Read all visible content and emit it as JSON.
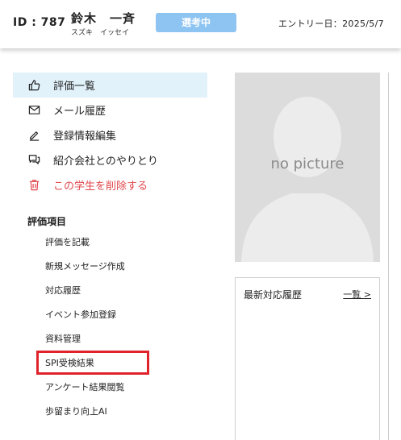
{
  "header": {
    "id_label": "ID : 787",
    "name": "鈴木　一斉",
    "name_kana": "スズキ　イッセイ",
    "status_badge": "選考中",
    "entry_date": "エントリー日：2025/5/7",
    "badge_color": "#8ec4f2"
  },
  "menu": {
    "items": [
      {
        "label": "評価一覧",
        "icon": "thumbs-up-icon"
      },
      {
        "label": "メール履歴",
        "icon": "envelope-icon"
      },
      {
        "label": "登録情報編集",
        "icon": "pencil-icon"
      },
      {
        "label": "紹介会社とのやりとり",
        "icon": "chat-bubbles-icon"
      },
      {
        "label": "この学生を削除する",
        "icon": "trash-icon"
      }
    ],
    "active_color": "#e1f2fb",
    "danger_color": "#e0474c"
  },
  "evaluation": {
    "title": "評価項目",
    "items": [
      "評価を記載",
      "新規メッセージ作成",
      "対応履歴",
      "イベント参加登録",
      "資料管理",
      "SPI受検結果",
      "アンケート結果閲覧",
      "歩留まり向上AI"
    ],
    "highlight_color": "#e0232b"
  },
  "photo": {
    "placeholder": "no picture"
  },
  "history": {
    "title": "最新対応履歴",
    "link": "一覧 >"
  }
}
